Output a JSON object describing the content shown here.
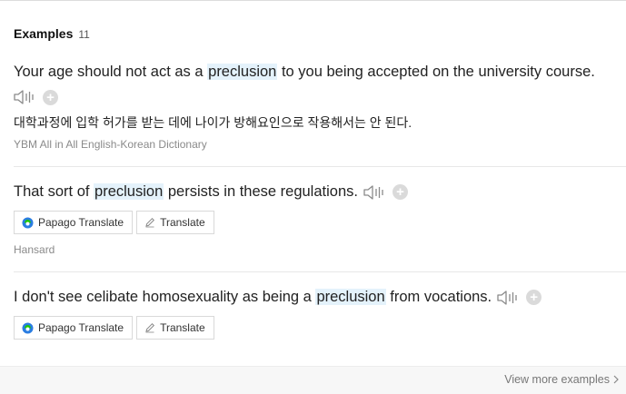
{
  "header": {
    "title": "Examples",
    "count": "11"
  },
  "examples": [
    {
      "pre": "Your age should not act as a ",
      "highlight": "preclusion",
      "post": " to you being accepted on the university course.",
      "translation": "대학과정에 입학 허가를 받는 데에 나이가 방해요인으로 작용해서는 안 된다.",
      "source": "YBM All in All English-Korean Dictionary"
    },
    {
      "pre": "That sort of ",
      "highlight": "preclusion",
      "post": " persists in these regulations.",
      "source": "Hansard",
      "papago_label": "Papago Translate",
      "translate_label": "Translate"
    },
    {
      "pre": "I don't see celibate homosexuality as being a ",
      "highlight": "preclusion",
      "post": " from vocations.",
      "papago_label": "Papago Translate",
      "translate_label": "Translate"
    }
  ],
  "footer": {
    "more_label": "View more examples"
  },
  "icons": {
    "speaker": "speaker-icon",
    "add": "add-icon",
    "papago": "papago-logo-icon",
    "pencil": "pencil-icon",
    "chevron": "chevron-right-icon"
  },
  "colors": {
    "highlight": "#e4f2fb",
    "papago_green": "#1ec800",
    "papago_blue": "#2a7de1"
  }
}
